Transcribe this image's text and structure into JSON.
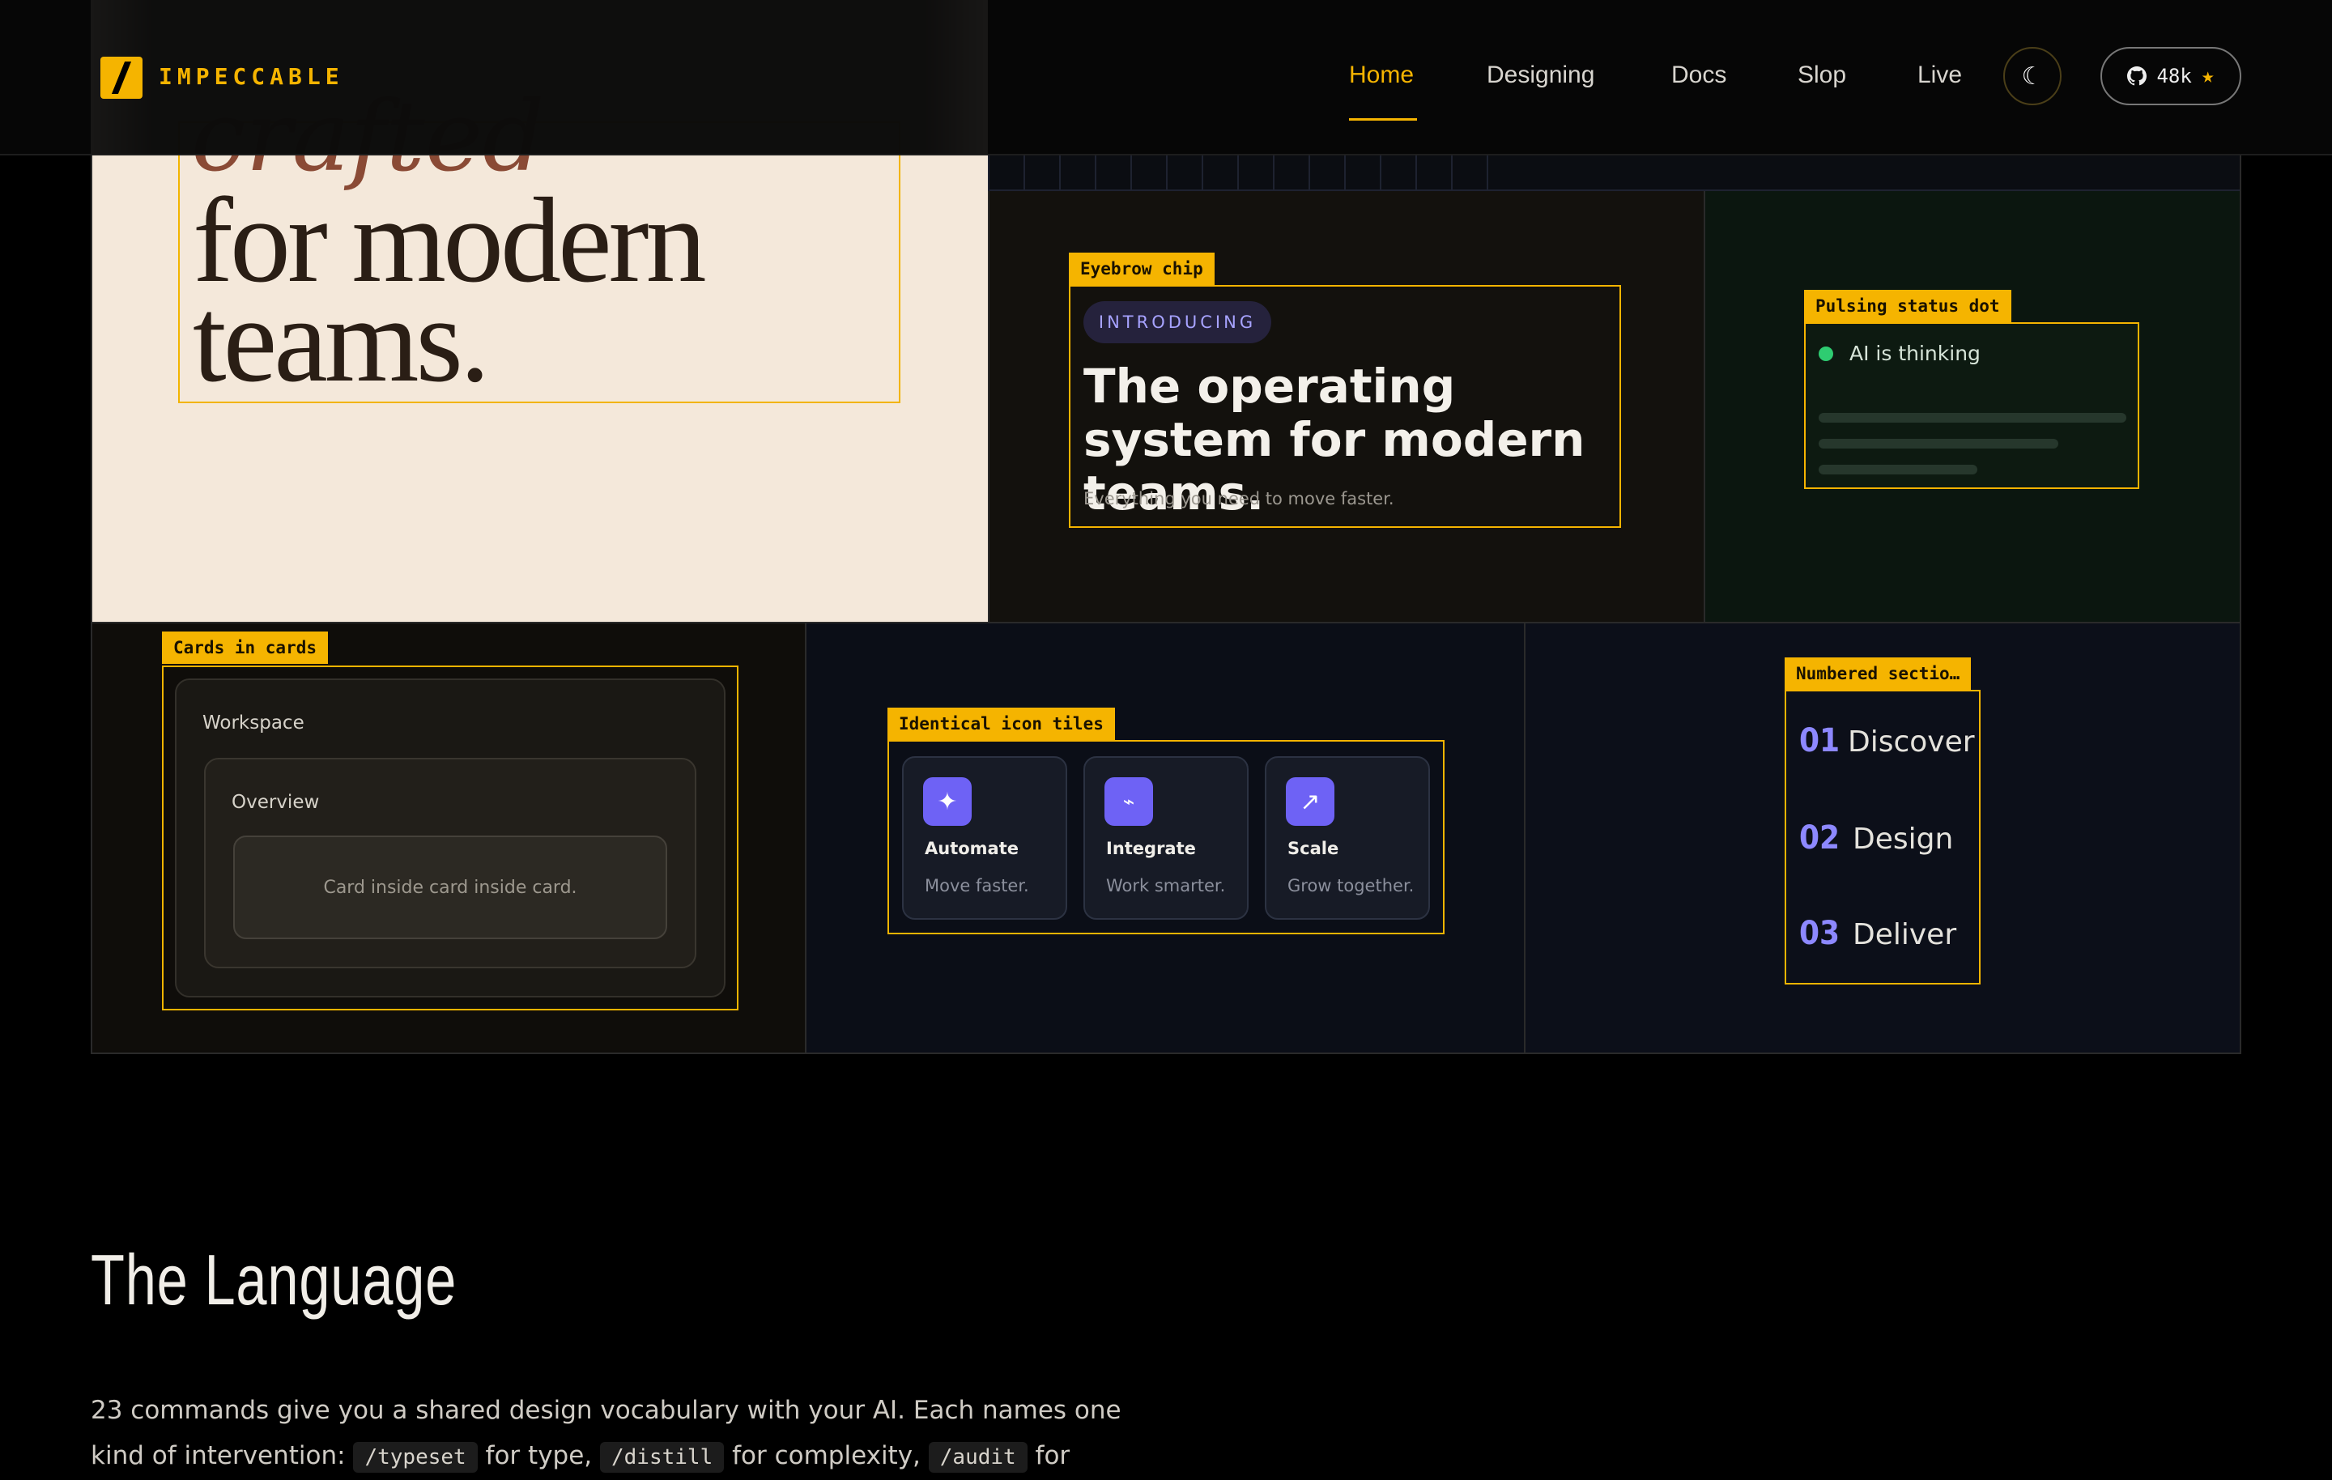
{
  "header": {
    "logo_text": "IMPECCABLE",
    "nav": [
      "Home",
      "Designing",
      "Docs",
      "Slop",
      "Live"
    ],
    "active_nav": "Home",
    "github_stars": "48k"
  },
  "hero": {
    "italic_word": "crafted",
    "headline_line1": "for modern",
    "headline_line2": "teams."
  },
  "tags": {
    "eyebrow": "Eyebrow chip",
    "pulsing": "Pulsing status dot",
    "cards": "Cards in cards",
    "tiles": "Identical icon tiles",
    "numbered": "Numbered sectio…"
  },
  "eyebrow_card": {
    "chip": "INTRODUCING",
    "title": "The operating system for modern teams.",
    "subtitle": "Everything you need to move faster."
  },
  "status_card": {
    "text": "AI is thinking",
    "color": "#2ecc71"
  },
  "cards_in_cards": {
    "outer": "Workspace",
    "middle": "Overview",
    "inner": "Card inside card inside card."
  },
  "tiles": [
    {
      "name": "Automate",
      "desc": "Move faster.",
      "icon": "sparkle-icon"
    },
    {
      "name": "Integrate",
      "desc": "Work smarter.",
      "icon": "bolt-icon"
    },
    {
      "name": "Scale",
      "desc": "Grow together.",
      "icon": "arrow-up-right-icon"
    }
  ],
  "numbered": [
    {
      "num": "01",
      "label": "Discover"
    },
    {
      "num": "02",
      "label": "Design"
    },
    {
      "num": "03",
      "label": "Deliver"
    }
  ],
  "language": {
    "title": "The Language",
    "body_part1": "23 commands give you a shared design vocabulary with your AI. Each names one kind of intervention: ",
    "code1": "/typeset",
    "body_part2": " for type, ",
    "code2": "/distill",
    "body_part3": " for complexity, ",
    "code3": "/audit",
    "body_part4": " for"
  },
  "colors": {
    "accent": "#f5b400",
    "cream": "#f4e8da",
    "indigo": "#6e62f5"
  }
}
